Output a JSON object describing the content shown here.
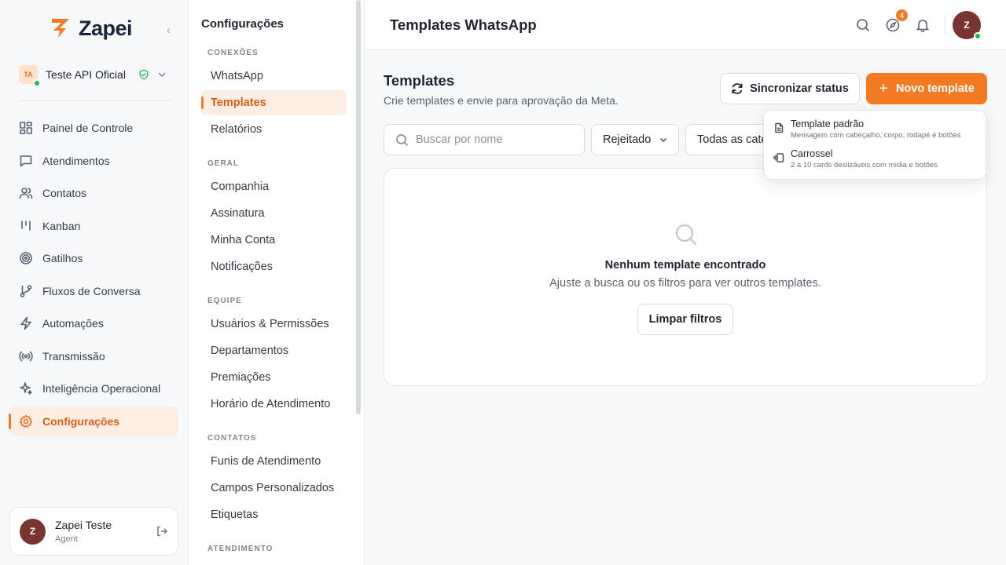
{
  "brand": {
    "name": "Zapei",
    "accent": "#F27A22"
  },
  "org": {
    "initials": "TA",
    "name": "Teste API Oficial"
  },
  "nav": [
    {
      "label": "Painel de Controle",
      "icon": "dashboard-icon"
    },
    {
      "label": "Atendimentos",
      "icon": "chat-icon"
    },
    {
      "label": "Contatos",
      "icon": "users-icon"
    },
    {
      "label": "Kanban",
      "icon": "kanban-icon"
    },
    {
      "label": "Gatilhos",
      "icon": "target-icon"
    },
    {
      "label": "Fluxos de Conversa",
      "icon": "flow-icon"
    },
    {
      "label": "Automações",
      "icon": "bolt-icon"
    },
    {
      "label": "Transmissão",
      "icon": "broadcast-icon"
    },
    {
      "label": "Inteligência Operacional",
      "icon": "sparkle-icon"
    },
    {
      "label": "Configurações",
      "icon": "gear-icon",
      "active": true
    }
  ],
  "user": {
    "initial": "Z",
    "name": "Zapei Teste",
    "role": "Agent"
  },
  "settings": {
    "title": "Configurações",
    "sections": [
      {
        "label": "CONEXÕES",
        "items": [
          "WhatsApp",
          "Templates",
          "Relatórios"
        ]
      },
      {
        "label": "GERAL",
        "items": [
          "Companhia",
          "Assinatura",
          "Minha Conta",
          "Notificações"
        ]
      },
      {
        "label": "EQUIPE",
        "items": [
          "Usuários & Permissões",
          "Departamentos",
          "Premiações",
          "Horário de Atendimento"
        ]
      },
      {
        "label": "CONTATOS",
        "items": [
          "Funis de Atendimento",
          "Campos Personalizados",
          "Etiquetas"
        ]
      },
      {
        "label": "ATENDIMENTO",
        "items": []
      }
    ],
    "active": "Templates"
  },
  "topbar": {
    "title": "Templates WhatsApp",
    "badge": "4",
    "avatar_initial": "Z"
  },
  "header": {
    "title": "Templates",
    "subtitle": "Crie templates e envie para aprovação da Meta.",
    "sync_label": "Sincronizar status",
    "new_label": "Novo template"
  },
  "filters": {
    "search_placeholder": "Buscar por nome",
    "status": "Rejeitado",
    "category": "Todas as categorias"
  },
  "empty": {
    "title": "Nenhum template encontrado",
    "subtitle": "Ajuste a busca ou os filtros para ver outros templates.",
    "clear_label": "Limpar filtros"
  },
  "new_menu": [
    {
      "title": "Template padrão",
      "desc": "Mensagem com cabeçalho, corpo, rodapé e botões",
      "icon": "document-icon"
    },
    {
      "title": "Carrossel",
      "desc": "2 a 10 cards deslizáveis com mídia e botões",
      "icon": "carousel-icon"
    }
  ]
}
